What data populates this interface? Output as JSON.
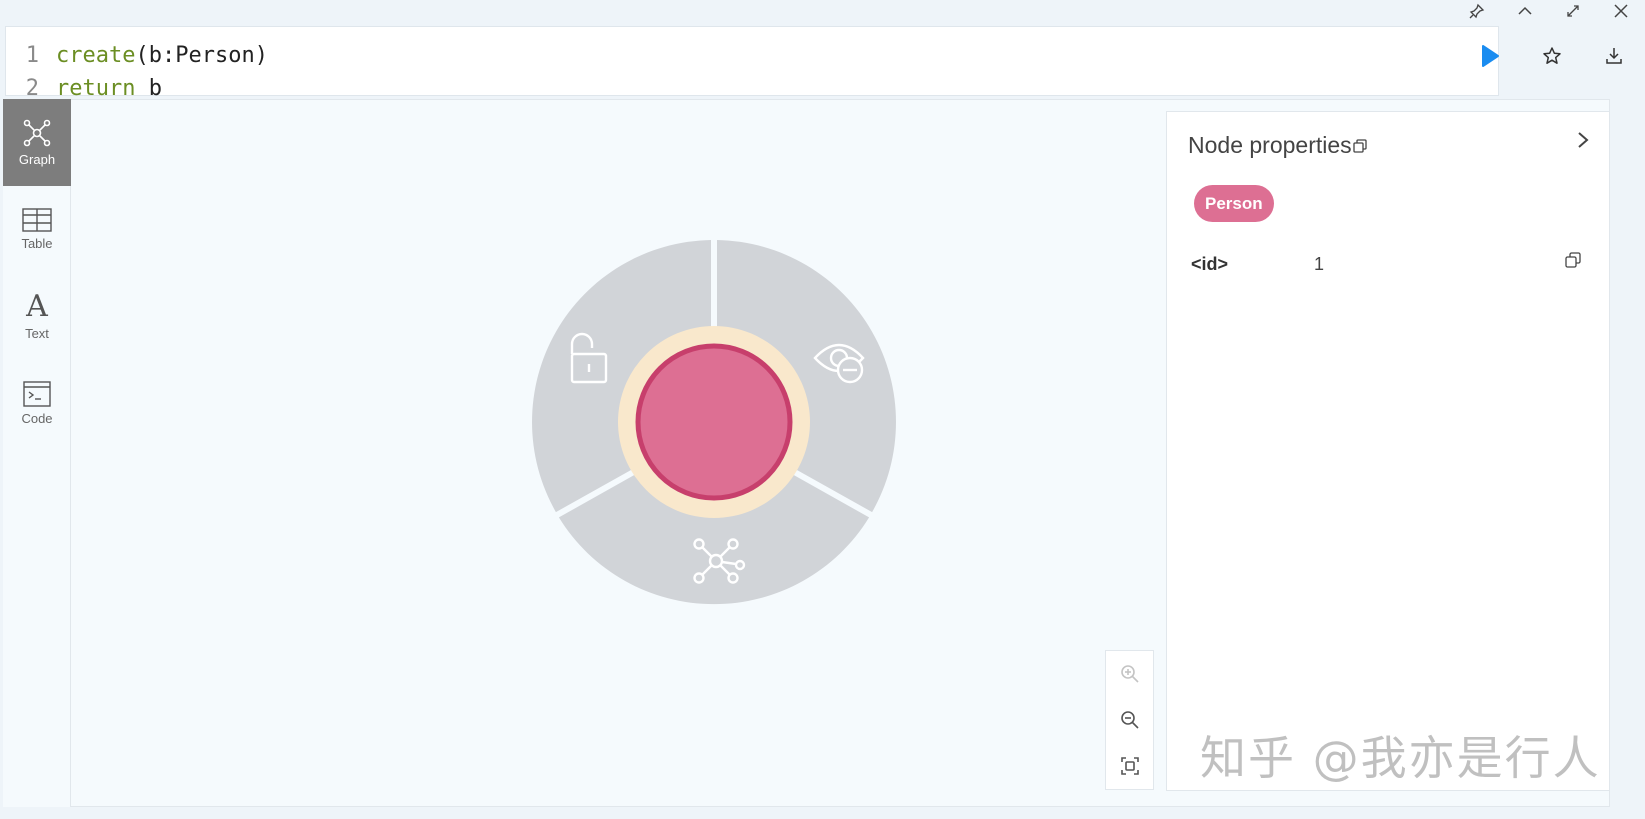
{
  "editor": {
    "lines": [
      {
        "num": "1",
        "kw": "create",
        "rest": "(b:Person)"
      },
      {
        "num": "2",
        "kw": "return",
        "rest": " b"
      }
    ]
  },
  "window_controls": [
    "pin-icon",
    "collapse-up-icon",
    "expand-icon",
    "close-icon"
  ],
  "toolbar": [
    "run-icon",
    "star-icon",
    "download-icon"
  ],
  "sidebar": {
    "items": [
      {
        "label": "Graph",
        "icon": "graph-icon",
        "active": true
      },
      {
        "label": "Table",
        "icon": "table-icon",
        "active": false
      },
      {
        "label": "Text",
        "icon": "text-icon",
        "active": false
      },
      {
        "label": "Code",
        "icon": "code-icon",
        "active": false
      }
    ]
  },
  "graph": {
    "node_color": "#dd6f93",
    "node_border": "#c73f6c",
    "halo_color": "#f9e8cc",
    "menu_color": "#d1d4d8",
    "menu_items": [
      "unlock-icon",
      "hide-icon",
      "expand-relationships-icon"
    ]
  },
  "zoom": [
    "zoom-in-icon",
    "zoom-out-icon",
    "fit-icon"
  ],
  "properties_panel": {
    "title": "Node properties",
    "label_badge": "Person",
    "rows": [
      {
        "key": "<id>",
        "value": "1"
      }
    ]
  },
  "watermark": "知乎 @我亦是行人"
}
